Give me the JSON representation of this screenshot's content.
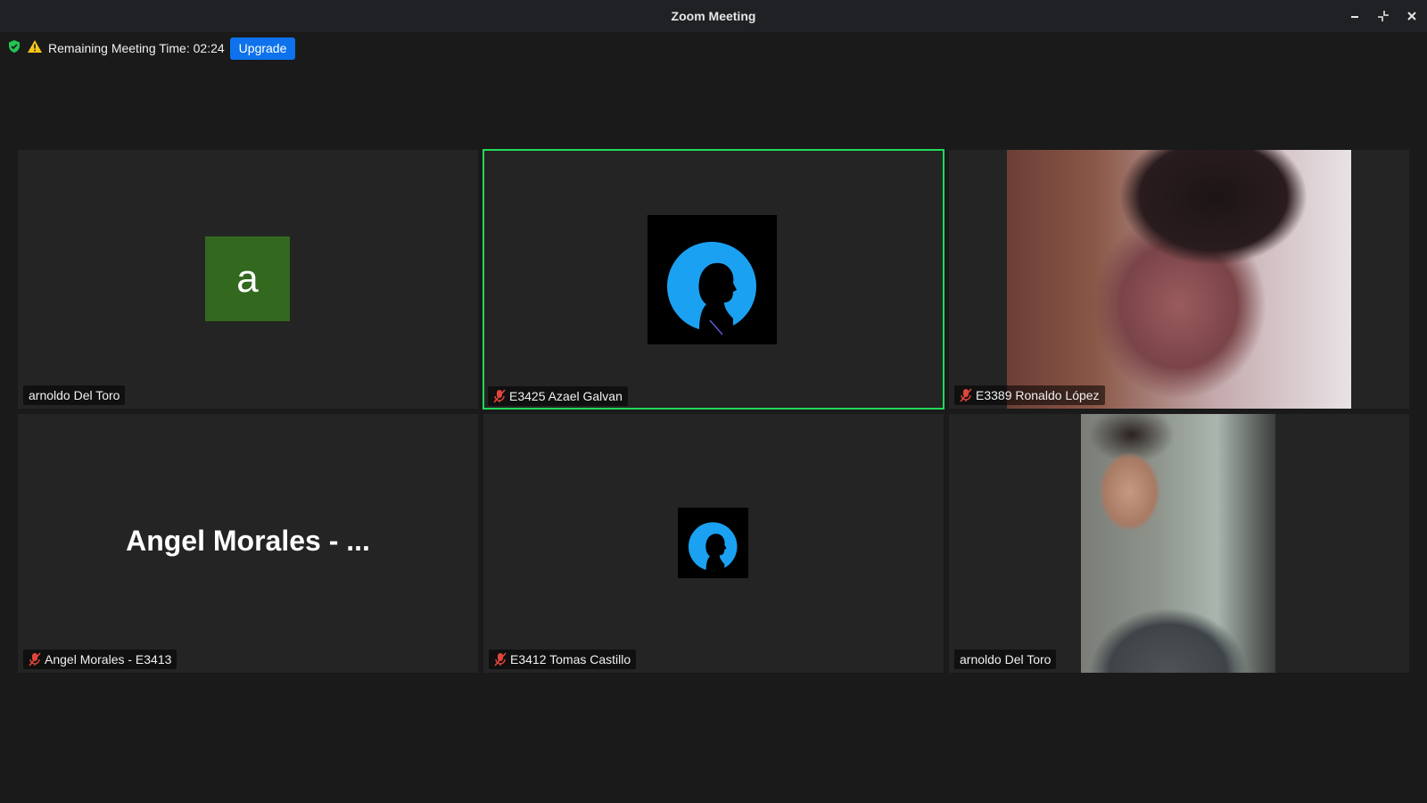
{
  "window": {
    "title": "Zoom Meeting"
  },
  "infobar": {
    "remaining_text": "Remaining Meeting Time: 02:24",
    "upgrade_label": "Upgrade"
  },
  "tiles": [
    {
      "name": "arnoldo Del Toro",
      "avatar_letter": "a",
      "avatar_color": "#33691e",
      "muted": false
    },
    {
      "name": "E3425 Azael Galvan",
      "avatar": "profile-silhouette",
      "muted": true,
      "active_speaker": true
    },
    {
      "name": "E3389 Ronaldo López",
      "video": "camera-feed",
      "muted": true
    },
    {
      "name": "Angel Morales - E3413",
      "display_name": "Angel Morales - ...",
      "muted": true
    },
    {
      "name": "E3412 Tomas Castillo",
      "avatar": "profile-silhouette",
      "muted": true
    },
    {
      "name": "arnoldo Del Toro",
      "video": "camera-feed",
      "muted": false
    }
  ],
  "colors": {
    "active_border": "#23d959",
    "accent": "#0e72ed",
    "mute_icon": "#e0453a"
  }
}
